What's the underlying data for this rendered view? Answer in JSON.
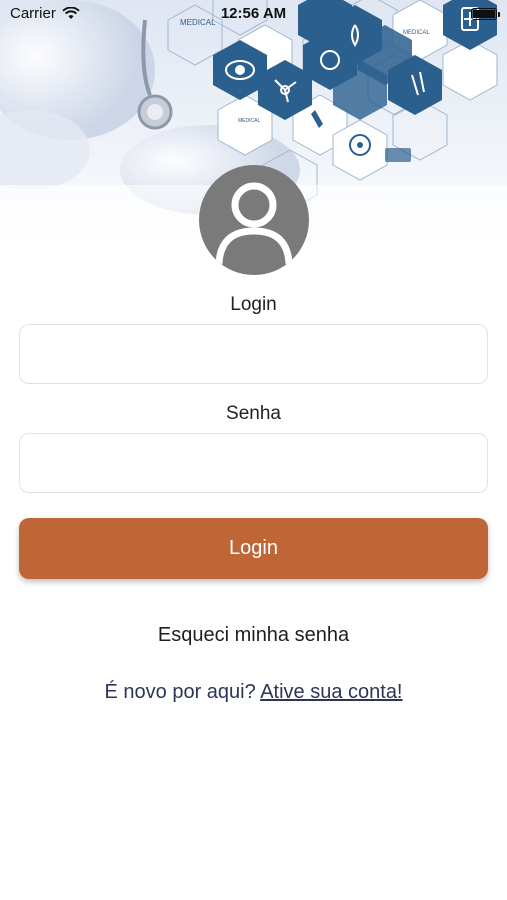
{
  "status_bar": {
    "carrier": "Carrier",
    "time": "12:56 AM"
  },
  "hero": {
    "hex_labels": [
      "MEDICAL",
      "MEDICAL",
      "MEDICAL"
    ]
  },
  "form": {
    "login_label": "Login",
    "login_value": "",
    "password_label": "Senha",
    "password_value": "",
    "submit_label": "Login"
  },
  "links": {
    "forgot_password": "Esqueci minha senha",
    "new_here": "É novo por aqui?",
    "activate_account": "Ative sua conta!"
  },
  "colors": {
    "accent": "#be6635",
    "link": "#2d3556",
    "avatar": "#7a7a7a",
    "hex_dark": "#2b5f8e"
  }
}
